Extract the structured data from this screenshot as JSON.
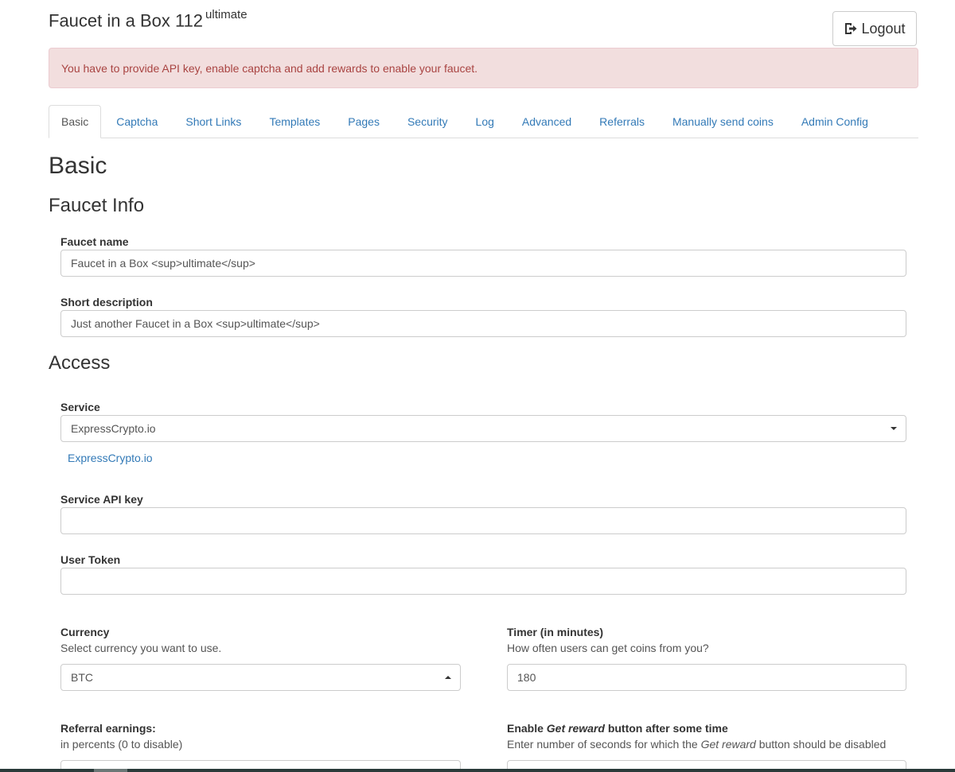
{
  "header": {
    "title": "Faucet in a Box 112",
    "title_sup": "ultimate",
    "logout_label": "Logout"
  },
  "alert": {
    "text": "You have to provide API key, enable captcha and add rewards to enable your faucet."
  },
  "tabs": [
    {
      "label": "Basic",
      "active": true
    },
    {
      "label": "Captcha"
    },
    {
      "label": "Short Links"
    },
    {
      "label": "Templates"
    },
    {
      "label": "Pages"
    },
    {
      "label": "Security"
    },
    {
      "label": "Log"
    },
    {
      "label": "Advanced"
    },
    {
      "label": "Referrals"
    },
    {
      "label": "Manually send coins"
    },
    {
      "label": "Admin Config"
    }
  ],
  "main": {
    "heading": "Basic",
    "faucet_info": {
      "heading": "Faucet Info",
      "name_label": "Faucet name",
      "name_value": "Faucet in a Box <sup>ultimate</sup>",
      "desc_label": "Short description",
      "desc_value": "Just another Faucet in a Box <sup>ultimate</sup>"
    },
    "access": {
      "heading": "Access",
      "service_label": "Service",
      "service_value": "ExpressCrypto.io",
      "service_link": "ExpressCrypto.io",
      "api_key_label": "Service API key",
      "api_key_value": "",
      "user_token_label": "User Token",
      "user_token_value": "",
      "currency_label": "Currency",
      "currency_help": "Select currency you want to use.",
      "currency_value": "BTC",
      "timer_label": "Timer (in minutes)",
      "timer_help": "How often users can get coins from you?",
      "timer_value": "180",
      "referral_label": "Referral earnings:",
      "referral_help": "in percents (0 to disable)",
      "reward_label_pre": "Enable ",
      "reward_label_em": "Get reward",
      "reward_label_post": " button after some time",
      "reward_help_pre": "Enter number of seconds for which the ",
      "reward_help_em": "Get reward",
      "reward_help_post": " button should be disabled"
    }
  },
  "colors": {
    "link": "#337ab7",
    "alert_bg": "#f2dede",
    "alert_text": "#a94442"
  }
}
